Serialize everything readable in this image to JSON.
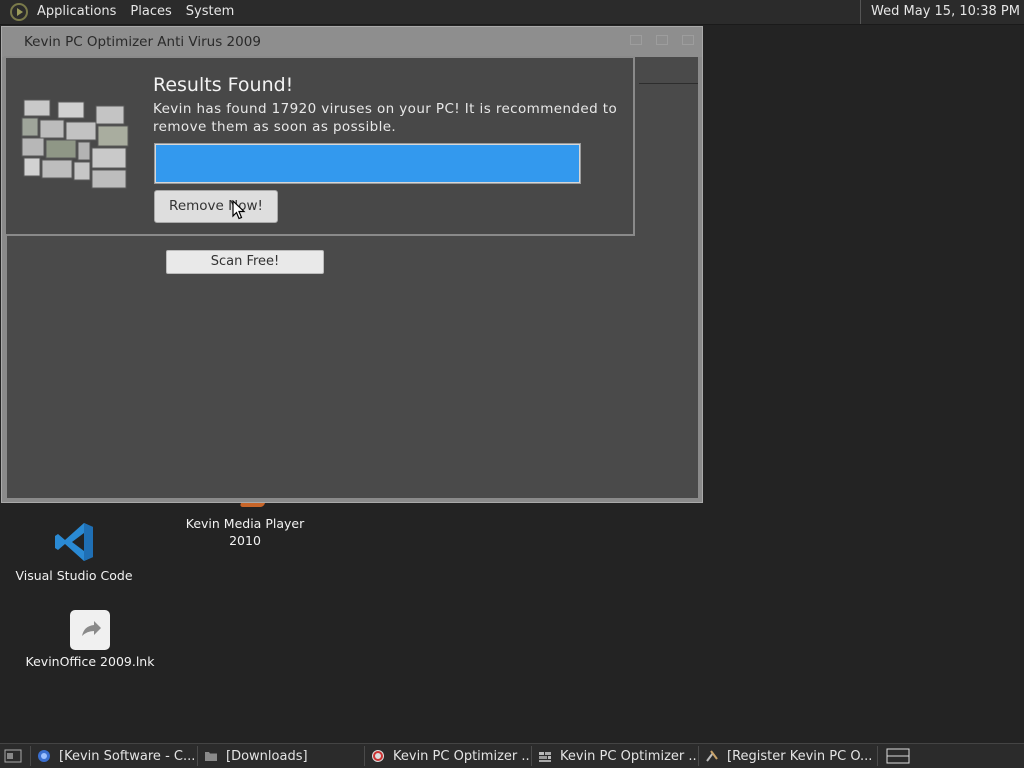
{
  "top_panel": {
    "menus": [
      "Applications",
      "Places",
      "System"
    ],
    "clock": "Wed May 15, 10:38 PM"
  },
  "desktop_icons": [
    {
      "label": "Kevin Media Player\n2010",
      "icon": "media-player-icon"
    },
    {
      "label": "Visual Studio Code",
      "icon": "vscode-icon"
    },
    {
      "label": "KevinOffice 2009.lnk",
      "icon": "shortcut-icon"
    }
  ],
  "main_window": {
    "title": "Kevin PC Optimizer Anti Virus 2009",
    "scan_button": "Scan Free!"
  },
  "dialog": {
    "title": "Results Found!",
    "message": "Kevin has found 17920 viruses on your PC! It is recommended to\nremove them as soon as possible.",
    "progress_fraction": 1.0,
    "progress_color": "#3399ee",
    "remove_button": "Remove Now!"
  },
  "taskbar": {
    "tasks": [
      {
        "label": "[Kevin Software - C...",
        "icon": "browser-icon"
      },
      {
        "label": "[Downloads]",
        "icon": "folder-icon"
      },
      {
        "label": "Kevin PC Optimizer ...",
        "icon": "optimizer-icon"
      },
      {
        "label": "Kevin PC Optimizer ...",
        "icon": "wall-icon"
      },
      {
        "label": "[Register Kevin PC O...",
        "icon": "tools-icon"
      }
    ]
  }
}
